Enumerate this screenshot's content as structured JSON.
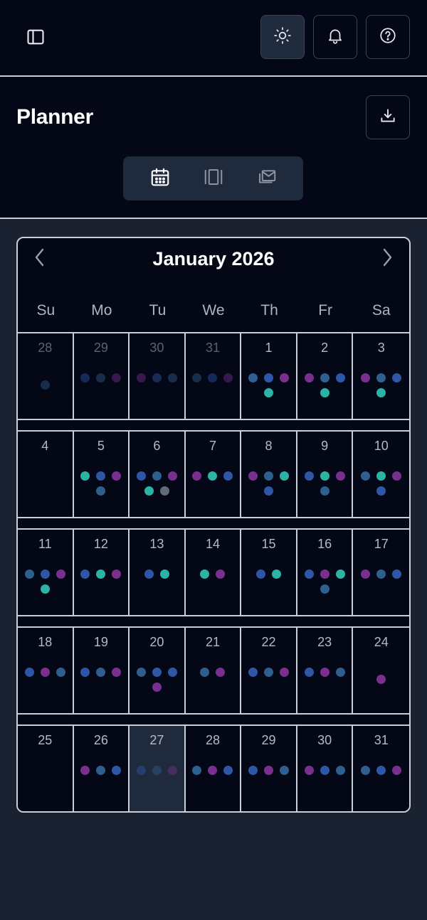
{
  "app": {
    "page_title": "Planner"
  },
  "calendar": {
    "month_label": "January 2026",
    "weekdays": [
      "Su",
      "Mo",
      "Tu",
      "We",
      "Th",
      "Fr",
      "Sa"
    ],
    "colors": {
      "blue": "#2e56a6",
      "teal": "#2bb3a3",
      "purple": "#7a2f8f",
      "slate": "#2f5f8f",
      "gray": "#5f6b7a"
    },
    "today": 27,
    "weeks": [
      [
        {
          "day": "28",
          "outside": true,
          "dots": [
            "slate"
          ]
        },
        {
          "day": "29",
          "outside": true,
          "dots": [
            "blue",
            "slate",
            "purple"
          ]
        },
        {
          "day": "30",
          "outside": true,
          "dots": [
            "purple",
            "blue",
            "slate"
          ]
        },
        {
          "day": "31",
          "outside": true,
          "dots": [
            "slate",
            "blue",
            "purple"
          ]
        },
        {
          "day": "1",
          "dots": [
            "slate",
            "blue",
            "purple",
            "teal"
          ]
        },
        {
          "day": "2",
          "dots": [
            "purple",
            "slate",
            "blue",
            "teal"
          ]
        },
        {
          "day": "3",
          "dots": [
            "purple",
            "slate",
            "blue",
            "teal"
          ]
        }
      ],
      [
        {
          "day": "4",
          "dots": []
        },
        {
          "day": "5",
          "dots": [
            "teal",
            "blue",
            "purple",
            "slate"
          ]
        },
        {
          "day": "6",
          "dots": [
            "blue",
            "slate",
            "purple",
            "teal",
            "gray"
          ]
        },
        {
          "day": "7",
          "dots": [
            "purple",
            "teal",
            "blue"
          ]
        },
        {
          "day": "8",
          "dots": [
            "purple",
            "slate",
            "teal",
            "blue"
          ]
        },
        {
          "day": "9",
          "dots": [
            "blue",
            "teal",
            "purple",
            "slate"
          ]
        },
        {
          "day": "10",
          "dots": [
            "slate",
            "teal",
            "purple",
            "blue"
          ]
        }
      ],
      [
        {
          "day": "11",
          "dots": [
            "slate",
            "blue",
            "purple",
            "teal"
          ]
        },
        {
          "day": "12",
          "dots": [
            "blue",
            "teal",
            "purple"
          ]
        },
        {
          "day": "13",
          "dots": [
            "blue",
            "teal"
          ]
        },
        {
          "day": "14",
          "dots": [
            "teal",
            "purple"
          ]
        },
        {
          "day": "15",
          "dots": [
            "blue",
            "teal"
          ]
        },
        {
          "day": "16",
          "dots": [
            "blue",
            "purple",
            "teal",
            "slate"
          ]
        },
        {
          "day": "17",
          "dots": [
            "purple",
            "slate",
            "blue"
          ]
        }
      ],
      [
        {
          "day": "18",
          "dots": [
            "blue",
            "purple",
            "slate"
          ]
        },
        {
          "day": "19",
          "dots": [
            "blue",
            "slate",
            "purple"
          ]
        },
        {
          "day": "20",
          "dots": [
            "slate",
            "blue",
            "blue",
            "purple"
          ]
        },
        {
          "day": "21",
          "dots": [
            "slate",
            "purple"
          ]
        },
        {
          "day": "22",
          "dots": [
            "blue",
            "slate",
            "purple"
          ]
        },
        {
          "day": "23",
          "dots": [
            "blue",
            "purple",
            "slate"
          ]
        },
        {
          "day": "24",
          "dots": [
            "purple"
          ]
        }
      ],
      [
        {
          "day": "25",
          "dots": []
        },
        {
          "day": "26",
          "dots": [
            "purple",
            "slate",
            "blue"
          ]
        },
        {
          "day": "27",
          "today": true,
          "dots": [
            "blue",
            "slate",
            "purple"
          ]
        },
        {
          "day": "28",
          "dots": [
            "slate",
            "purple",
            "blue"
          ]
        },
        {
          "day": "29",
          "dots": [
            "blue",
            "purple",
            "slate"
          ]
        },
        {
          "day": "30",
          "dots": [
            "purple",
            "blue",
            "slate"
          ]
        },
        {
          "day": "31",
          "dots": [
            "slate",
            "blue",
            "purple"
          ]
        }
      ]
    ]
  },
  "icons": {
    "sidebar": "sidebar-toggle-icon",
    "theme": "sun-icon",
    "notifications": "bell-icon",
    "help": "help-circle-icon",
    "download": "download-icon",
    "view_calendar": "calendar-icon",
    "view_board": "columns-icon",
    "view_inbox": "mail-stack-icon",
    "prev": "chevron-left-icon",
    "next": "chevron-right-icon"
  }
}
